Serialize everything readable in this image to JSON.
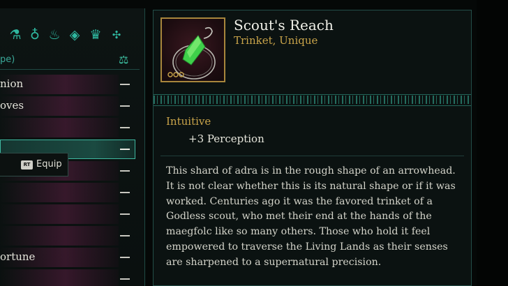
{
  "left_panel": {
    "subheader": "pe)",
    "category_icons": [
      {
        "name": "potion-icon",
        "glyph": "⚗"
      },
      {
        "name": "ring-icon",
        "glyph": "♁"
      },
      {
        "name": "lamp-icon",
        "glyph": "♨"
      },
      {
        "name": "gem-icon",
        "glyph": "◈"
      },
      {
        "name": "crown-icon",
        "glyph": "♛"
      },
      {
        "name": "gamepad-icon",
        "glyph": "✣"
      }
    ],
    "items": [
      {
        "label": "nion"
      },
      {
        "label": "oves"
      },
      {
        "label": ""
      },
      {
        "label": "",
        "selected": true
      },
      {
        "label": ""
      },
      {
        "label": ""
      },
      {
        "label": ""
      },
      {
        "label": ""
      },
      {
        "label": "ortune"
      },
      {
        "label": ""
      }
    ],
    "equip_popup": {
      "button_badge": "RT",
      "label": "Equip"
    }
  },
  "item": {
    "name": "Scout's Reach",
    "type": "Trinket, Unique",
    "stat_title": "Intuitive",
    "stat_value": "+3 Perception",
    "description_lines": [
      "This shard of adra is in the rough shape of an arrowhead.",
      "It is not clear whether this is its natural shape or if it was",
      "worked. Centuries ago it was the favored trinket of a",
      "Godless scout, who met their end at the hands of the",
      "maegfolc like so many others. Those who hold it feel",
      "empowered to traverse the Living Lands as their senses",
      "are sharpened to a supernatural precision."
    ]
  },
  "colors": {
    "accent_teal": "#2fb8a0",
    "gold": "#c9a44a",
    "panel_bg": "#0b1211"
  }
}
